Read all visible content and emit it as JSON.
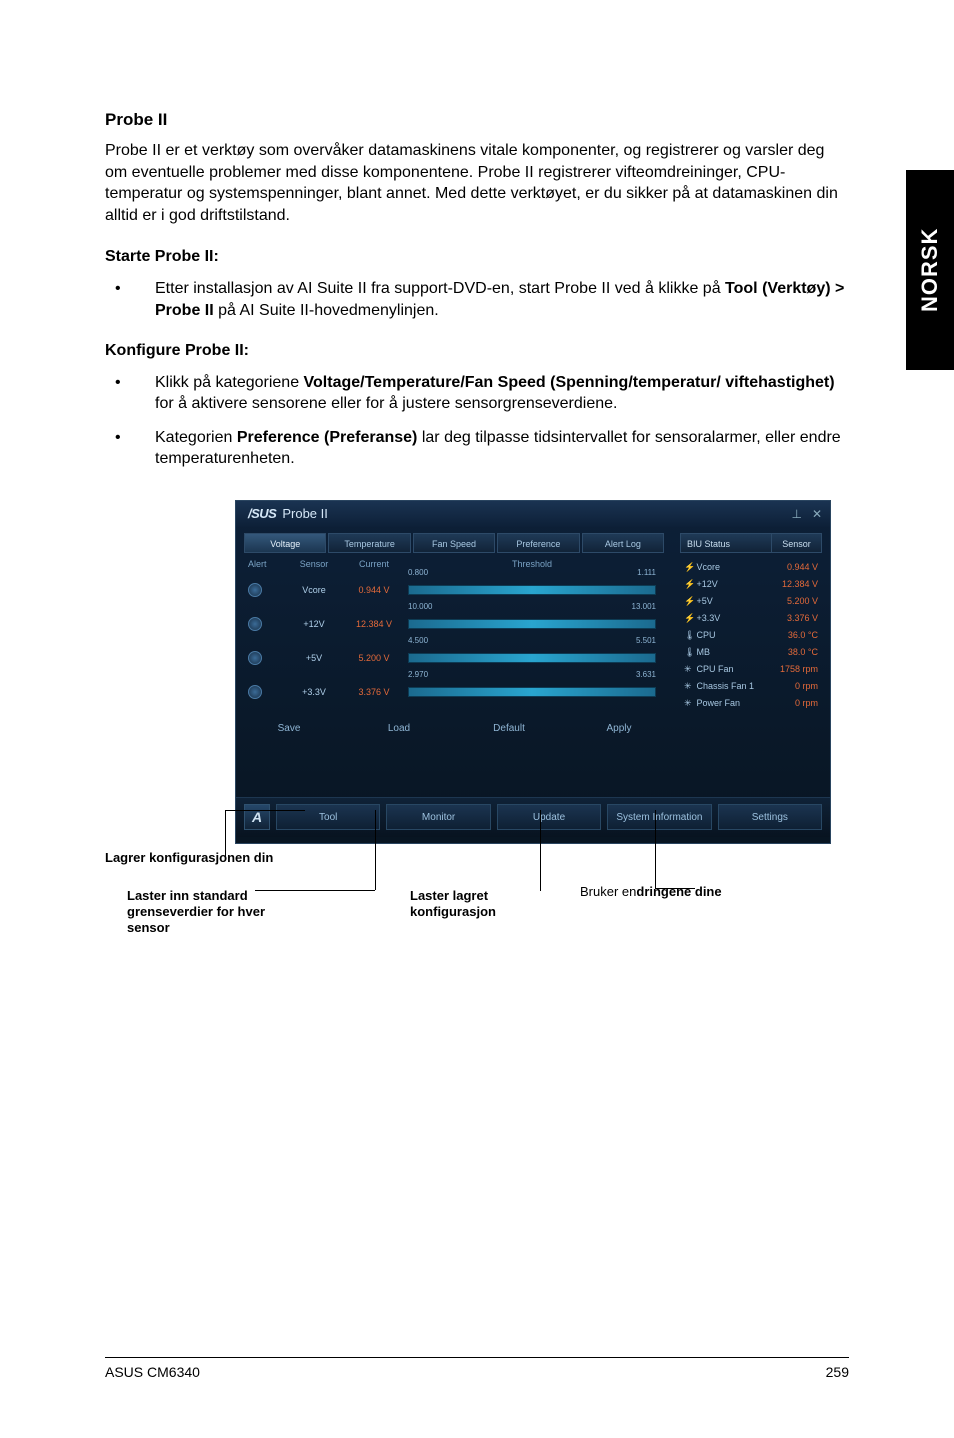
{
  "sideTab": "NORSK",
  "heading": "Probe II",
  "intro": "Probe II er et verktøy som overvåker datamaskinens vitale komponenter, og registrerer og varsler deg om eventuelle problemer med disse komponentene. Probe II registrerer vifteomdreininger, CPU-temperatur og systemspenninger, blant annet. Med dette verktøyet, er du sikker på at datamaskinen din alltid er i god driftstilstand.",
  "start_heading": "Starte Probe II:",
  "start_item_pre": "Etter installasjon av AI Suite II fra support-DVD-en, start Probe II ved å klikke på ",
  "start_item_bold": "Tool (Verktøy) > Probe II",
  "start_item_post": " på AI Suite II-hovedmenylinjen.",
  "config_heading": "Konfigure Probe II:",
  "config_items": [
    {
      "pre": "Klikk på kategoriene ",
      "bold": "Voltage/Temperature/Fan Speed (Spenning/temperatur/ viftehastighet)",
      "post": " for å aktivere sensorene eller for å justere sensorgrenseverdiene."
    },
    {
      "pre": "Kategorien ",
      "bold": "Preference (Preferanse)",
      "post": " lar deg tilpasse tidsintervallet for sensoralarmer, eller endre temperaturenheten."
    }
  ],
  "probe": {
    "logo": "/SUS",
    "title": "Probe II",
    "tabs": [
      "Voltage",
      "Temperature",
      "Fan Speed",
      "Preference",
      "Alert Log"
    ],
    "headers": [
      "Alert",
      "Sensor",
      "Current",
      "Threshold"
    ],
    "rows": [
      {
        "name": "Vcore",
        "cur": "0.944 V",
        "lo": "0.800",
        "hi": "1.111"
      },
      {
        "name": "+12V",
        "cur": "12.384 V",
        "lo": "10.000",
        "hi": "13.001"
      },
      {
        "name": "+5V",
        "cur": "5.200 V",
        "lo": "4.500",
        "hi": "5.501"
      },
      {
        "name": "+3.3V",
        "cur": "3.376 V",
        "lo": "2.970",
        "hi": "3.631"
      }
    ],
    "buttons": [
      "Save",
      "Load",
      "Default",
      "Apply"
    ],
    "status": {
      "left": "BIU Status",
      "right": "Sensor"
    },
    "stats": [
      {
        "ico": "⚡",
        "name": "Vcore",
        "val": "0.944 V"
      },
      {
        "ico": "⚡",
        "name": "+12V",
        "val": "12.384 V"
      },
      {
        "ico": "⚡",
        "name": "+5V",
        "val": "5.200 V"
      },
      {
        "ico": "⚡",
        "name": "+3.3V",
        "val": "3.376 V"
      },
      {
        "ico": "🌡",
        "name": "CPU",
        "val": "36.0 °C"
      },
      {
        "ico": "🌡",
        "name": "MB",
        "val": "38.0 °C"
      },
      {
        "ico": "✳",
        "name": "CPU Fan",
        "val": "1758 rpm"
      },
      {
        "ico": "✳",
        "name": "Chassis Fan 1",
        "val": "0 rpm"
      },
      {
        "ico": "✳",
        "name": "Power Fan",
        "val": "0 rpm"
      }
    ],
    "bottom": [
      "Tool",
      "Monitor",
      "Update",
      "System Information",
      "Settings"
    ]
  },
  "callouts": {
    "save": "Lagrer konfigurasjonen din",
    "default": "Laster inn standard grenseverdier for hver sensor",
    "load": "Laster lagret konfigurasjon",
    "apply_pre": "Bruker en",
    "apply_bold": "dringene dine"
  },
  "footer": {
    "left": "ASUS CM6340",
    "right": "259"
  }
}
